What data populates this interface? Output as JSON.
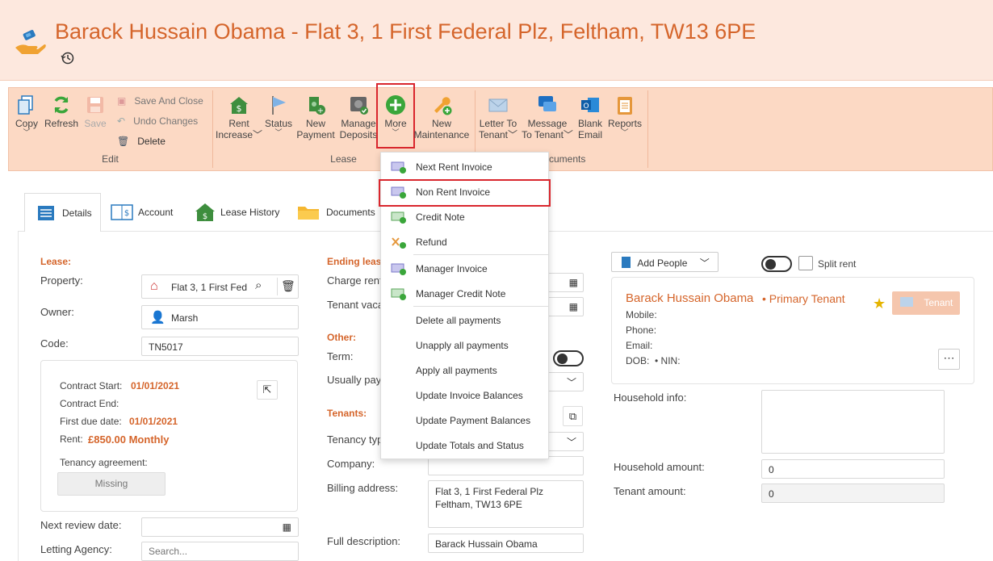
{
  "header": {
    "title": "Barack Hussain Obama - Flat 3, 1 First Federal Plz, Feltham, TW13 6PE",
    "history_icon": "history-icon",
    "logo_icon": "hand-money-icon"
  },
  "ribbon": {
    "copy": "Copy",
    "refresh": "Refresh",
    "save": "Save",
    "save_and_close": "Save And Close",
    "undo_changes": "Undo Changes",
    "delete": "Delete",
    "edit_group": "Edit",
    "rent_increase": [
      "Rent",
      "Increase"
    ],
    "status": "Status",
    "new_payment": [
      "New",
      "Payment"
    ],
    "manage_deposits": [
      "Manage",
      "Deposits"
    ],
    "more": "More",
    "lease_group": "Lease",
    "new_maintenance": [
      "New",
      "Maintenance"
    ],
    "letter_to_tenant": [
      "Letter To",
      "Tenant"
    ],
    "message_to_tenant": [
      "Message",
      "To Tenant"
    ],
    "blank_email": [
      "Blank",
      "Email"
    ],
    "reports": "Reports",
    "documents_group": "Documents"
  },
  "menu": {
    "items": [
      "Next Rent Invoice",
      "Non Rent Invoice",
      "Credit Note",
      "Refund",
      "Manager Invoice",
      "Manager Credit Note",
      "Delete all payments",
      "Unapply all payments",
      "Apply all payments",
      "Update Invoice Balances",
      "Update Payment Balances",
      "Update Totals and Status"
    ]
  },
  "tabs": [
    "Details",
    "Account",
    "Lease History",
    "Documents"
  ],
  "lease": {
    "section": "Lease:",
    "property_label": "Property:",
    "property_value": "Flat 3, 1 First Federal Plz",
    "owner_label": "Owner:",
    "owner_value": "Marsh",
    "code_label": "Code:",
    "code_value": "TN5017"
  },
  "contract": {
    "start_label": "Contract Start:",
    "start_value": "01/01/2021",
    "end_label": "Contract End:",
    "first_due_label": "First due date:",
    "first_due_value": "01/01/2021",
    "rent_label": "Rent:",
    "rent_value": "£850.00 Monthly",
    "agreement_label": "Tenancy agreement:",
    "missing": "Missing"
  },
  "next_review_label": "Next review date:",
  "letting_agency_label": "Letting Agency:",
  "search_placeholder": "Search...",
  "middle": {
    "ending_section": "Ending lease",
    "charge_rent": "Charge rent",
    "tenant_vacated": "Tenant vacated",
    "other_section": "Other:",
    "term": "Term:",
    "usually_pay": "Usually pays",
    "tenants_section": "Tenants:",
    "tenancy_type": "Tenancy type",
    "company": "Company:",
    "billing_address": "Billing address:",
    "billing_line1": "Flat 3, 1 First Federal Plz",
    "billing_line2": "Feltham, TW13 6PE",
    "full_description": "Full description:",
    "full_description_value": "Barack Hussain Obama"
  },
  "right": {
    "add_people": "Add People",
    "split_rent": "Split rent",
    "tenant_name": "Barack Hussain Obama",
    "primary": "• Primary Tenant",
    "tenant_badge": "Tenant",
    "mobile": "Mobile:",
    "phone": "Phone:",
    "email": "Email:",
    "dob": "DOB:  • NIN:",
    "household_info": "Household info:",
    "household_amount": "Household amount:",
    "household_amount_value": "0",
    "tenant_amount": "Tenant amount:",
    "tenant_amount_value": "0"
  },
  "colors": {
    "accent": "#d5652b",
    "ribbon": "#fcd9c4",
    "header": "#fde8de",
    "highlight": "#d9262d"
  }
}
